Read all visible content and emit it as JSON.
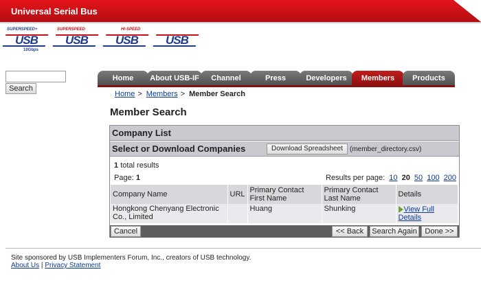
{
  "header": {
    "title": "Universal Serial Bus"
  },
  "logos": [
    {
      "name": "superspeed-plus-usb-10gbps-logo",
      "tag": "SUPERSPEED+",
      "text": "USB",
      "sub": "10Gbps"
    },
    {
      "name": "superspeed-usb-logo",
      "tag": "SUPERSPEED",
      "text": "USB",
      "sub": ""
    },
    {
      "name": "hi-speed-usb-logo",
      "tag": "HI-SPEED",
      "text": "USB",
      "sub": ""
    },
    {
      "name": "certified-usb-logo",
      "tag": "",
      "text": "USB",
      "sub": ""
    }
  ],
  "sidebar": {
    "search_value": "",
    "search_button": "Search"
  },
  "nav": {
    "tabs": [
      "Home",
      "About USB-IF",
      "Channel",
      "Press",
      "Developers",
      "Members",
      "Products"
    ],
    "active": "Members"
  },
  "breadcrumb": {
    "home": "Home",
    "members": "Members",
    "sep": ">",
    "current": "Member Search"
  },
  "page_title": "Member Search",
  "panel": {
    "title": "Company List",
    "subtitle": "Select or Download Companies",
    "download_button": "Download Spreadsheet",
    "download_file": "(member_directory.csv)",
    "total_count": "1",
    "total_suffix": "total results",
    "page_label": "Page:",
    "page_number": "1",
    "rpp_label": "Results per page:",
    "rpp_options": [
      "10",
      "20",
      "50",
      "100",
      "200"
    ],
    "rpp_selected": "20",
    "columns": [
      "Company Name",
      "URL",
      "Primary Contact First Name",
      "Primary Contact Last Name",
      "Details"
    ],
    "rows": [
      {
        "company": "Hongkong Chenyang Electronic Co., Limited",
        "url": "",
        "first": "Huang",
        "last": "Shunking",
        "details": "View Full Details"
      }
    ],
    "cancel_button": "Cancel",
    "back_button": "<< Back",
    "search_again_button": "Search Again",
    "done_button": "Done >>"
  },
  "footer": {
    "sponsor": "Site sponsored by USB Implementers Forum, Inc., creators of USB technology.",
    "about_link": "About Us",
    "divider": "|",
    "privacy_link": "Privacy Statement"
  }
}
